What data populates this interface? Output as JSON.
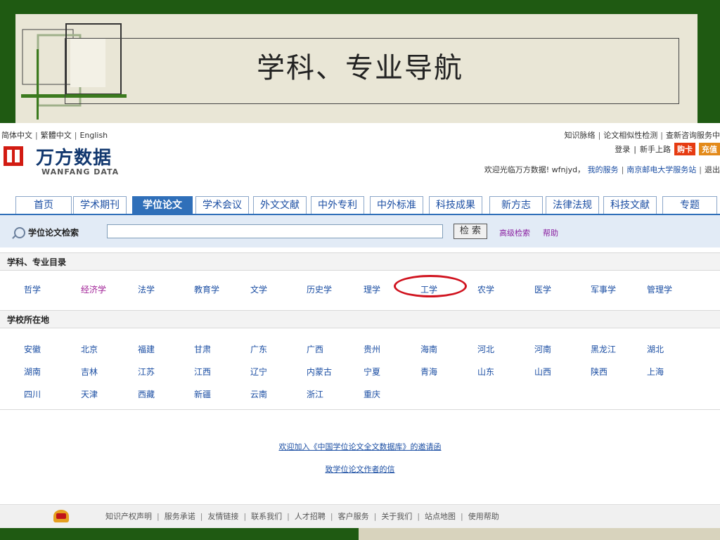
{
  "slide": {
    "title": "学科、专业导航"
  },
  "header": {
    "lang_links": [
      "简体中文",
      "繁體中文",
      "English"
    ],
    "top_links": [
      "知识脉络",
      "论文相似性检测",
      "查新咨询服务中"
    ],
    "login_label": "登录",
    "newbie_label": "新手上路",
    "buy_card_label": "购卡",
    "recharge_label": "充值",
    "welcome_text": "欢迎光临万方数据! wfnjyd，",
    "my_service_label": "我的服务",
    "station_label": "南京邮电大学服务站",
    "logout_label": "退出"
  },
  "logo": {
    "cn": "万方数据",
    "en": "WANFANG DATA"
  },
  "nav": {
    "tabs": [
      "首页",
      "学术期刊",
      "学位论文",
      "学术会议",
      "外文文献",
      "中外专利",
      "中外标准",
      "科技成果",
      "新方志",
      "法律法规",
      "科技文献",
      "专题"
    ],
    "active_index": 2
  },
  "search": {
    "label": "学位论文检索",
    "input_value": "",
    "button_label": "检 索",
    "advanced_label": "高级检索",
    "help_label": "帮助"
  },
  "subjects": {
    "heading": "学科、专业目录",
    "items": [
      "哲学",
      "经济学",
      "法学",
      "教育学",
      "文学",
      "历史学",
      "理学",
      "工学",
      "农学",
      "医学",
      "军事学",
      "管理学"
    ],
    "highlighted": "工学"
  },
  "locations": {
    "heading": "学校所在地",
    "rows": [
      [
        "安徽",
        "北京",
        "福建",
        "甘肃",
        "广东",
        "广西",
        "贵州",
        "海南",
        "河北",
        "河南",
        "黑龙江",
        "湖北"
      ],
      [
        "湖南",
        "吉林",
        "江苏",
        "江西",
        "辽宁",
        "内蒙古",
        "宁夏",
        "青海",
        "山东",
        "山西",
        "陕西",
        "上海"
      ],
      [
        "四川",
        "天津",
        "西藏",
        "新疆",
        "云南",
        "浙江",
        "重庆"
      ]
    ]
  },
  "invites": {
    "line1": "欢迎加入《中国学位论文全文数据库》的邀请函",
    "line2": "致学位论文作者的信"
  },
  "footer": {
    "links": [
      "知识产权声明",
      "服务承诺",
      "友情链接",
      "联系我们",
      "人才招聘",
      "客户服务",
      "关于我们",
      "站点地图",
      "使用帮助"
    ]
  },
  "colors": {
    "brand_green": "#1f5a12",
    "nav_blue": "#2f6fb9",
    "link_blue": "#1b4ea3",
    "highlight_red": "#d0121e"
  }
}
